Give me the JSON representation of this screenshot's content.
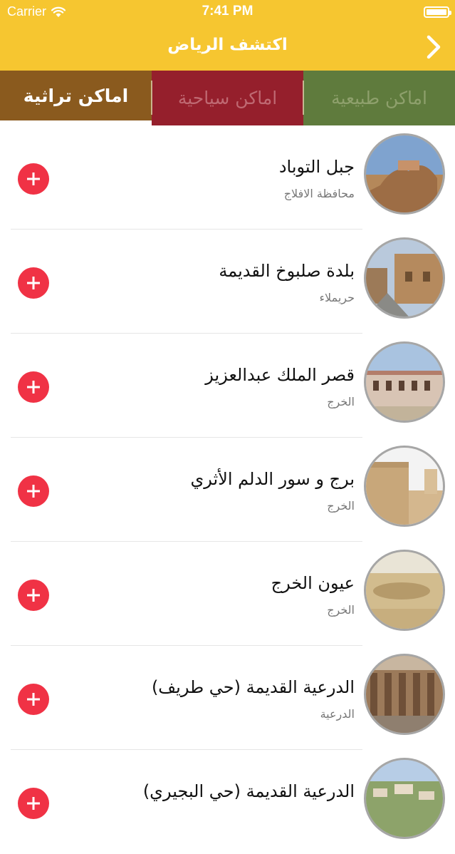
{
  "status_bar": {
    "carrier": "Carrier",
    "time": "7:41 PM"
  },
  "nav": {
    "title": "اكتشف الرياض",
    "back_icon": "chevron-right-icon"
  },
  "tabs": [
    {
      "label": "اماكن طبيعية",
      "color": "#5f7b3d"
    },
    {
      "label": "اماكن سياحية",
      "color": "#951f2c"
    },
    {
      "label": "اماكن تراثية",
      "color": "#8a5a1e",
      "selected": true
    }
  ],
  "colors": {
    "header": "#f6c630",
    "add_button": "#f03245"
  },
  "places": [
    {
      "title": "جبل التوباد",
      "subtitle": "محافظة الافلاج"
    },
    {
      "title": "بلدة صلبوخ القديمة",
      "subtitle": "حريملاء"
    },
    {
      "title": "قصر الملك عبدالعزيز",
      "subtitle": "الخرج"
    },
    {
      "title": "برج و سور الدلم الأثري",
      "subtitle": "الخرج"
    },
    {
      "title": "عيون الخرج",
      "subtitle": "الخرج"
    },
    {
      "title": "الدرعية القديمة (حي طريف)",
      "subtitle": "الدرعية"
    },
    {
      "title": "الدرعية القديمة (حي البجيري)",
      "subtitle": ""
    }
  ]
}
